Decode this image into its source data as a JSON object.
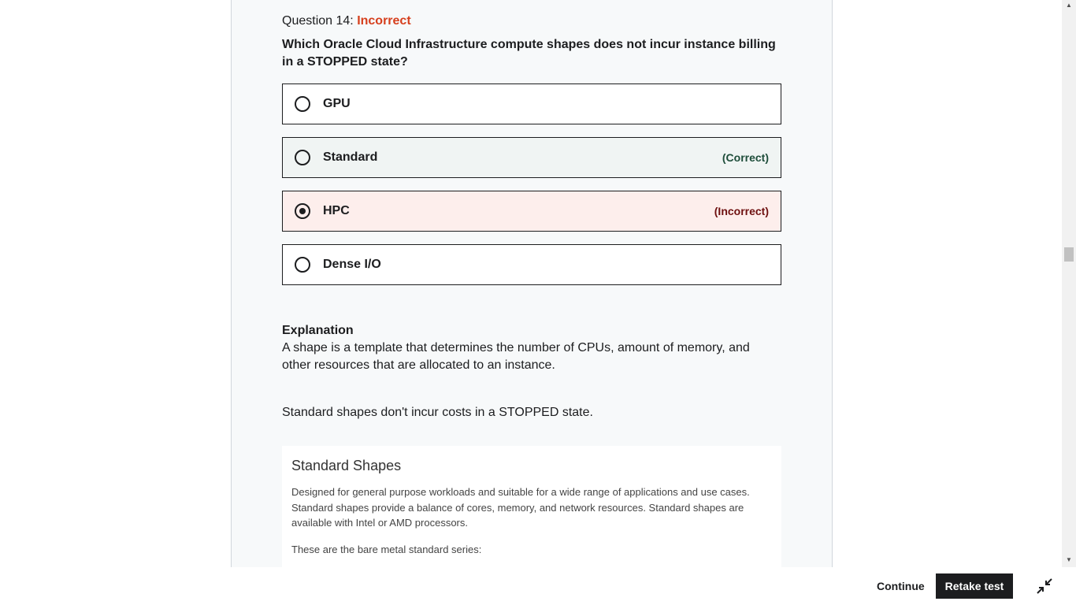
{
  "question": {
    "prefix": "Question 14:",
    "status": "Incorrect",
    "text": "Which Oracle Cloud Infrastructure compute shapes does not incur instance billing in a STOPPED state?"
  },
  "options": [
    {
      "label": "GPU",
      "tag": "",
      "state": "neutral",
      "selected": false
    },
    {
      "label": "Standard",
      "tag": "(Correct)",
      "state": "correct",
      "selected": false
    },
    {
      "label": "HPC",
      "tag": "(Incorrect)",
      "state": "incorrect",
      "selected": true
    },
    {
      "label": "Dense I/O",
      "tag": "",
      "state": "neutral",
      "selected": false
    }
  ],
  "explanation": {
    "title": "Explanation",
    "text": "A shape is a template that determines the number of CPUs, amount of memory, and other resources that are allocated to an instance.",
    "text2": "Standard shapes don't incur costs in a STOPPED state."
  },
  "image": {
    "title": "Standard Shapes",
    "para1": "Designed for general purpose workloads and suitable for a wide range of applications and use cases. Standard shapes provide a balance of cores, memory, and network resources. Standard shapes are available with Intel or AMD processors.",
    "para2": "These are the bare metal standard series:"
  },
  "footer": {
    "continue_label": "Continue",
    "retake_label": "Retake test"
  },
  "colors": {
    "incorrect_status": "#d63f1d",
    "correct_bg": "#f0f4f3",
    "incorrect_bg": "#fdeeec",
    "primary_button": "#1c1d1f"
  },
  "icons": {
    "collapse": "collapse-arrows-icon",
    "radio": "radio-icon"
  }
}
